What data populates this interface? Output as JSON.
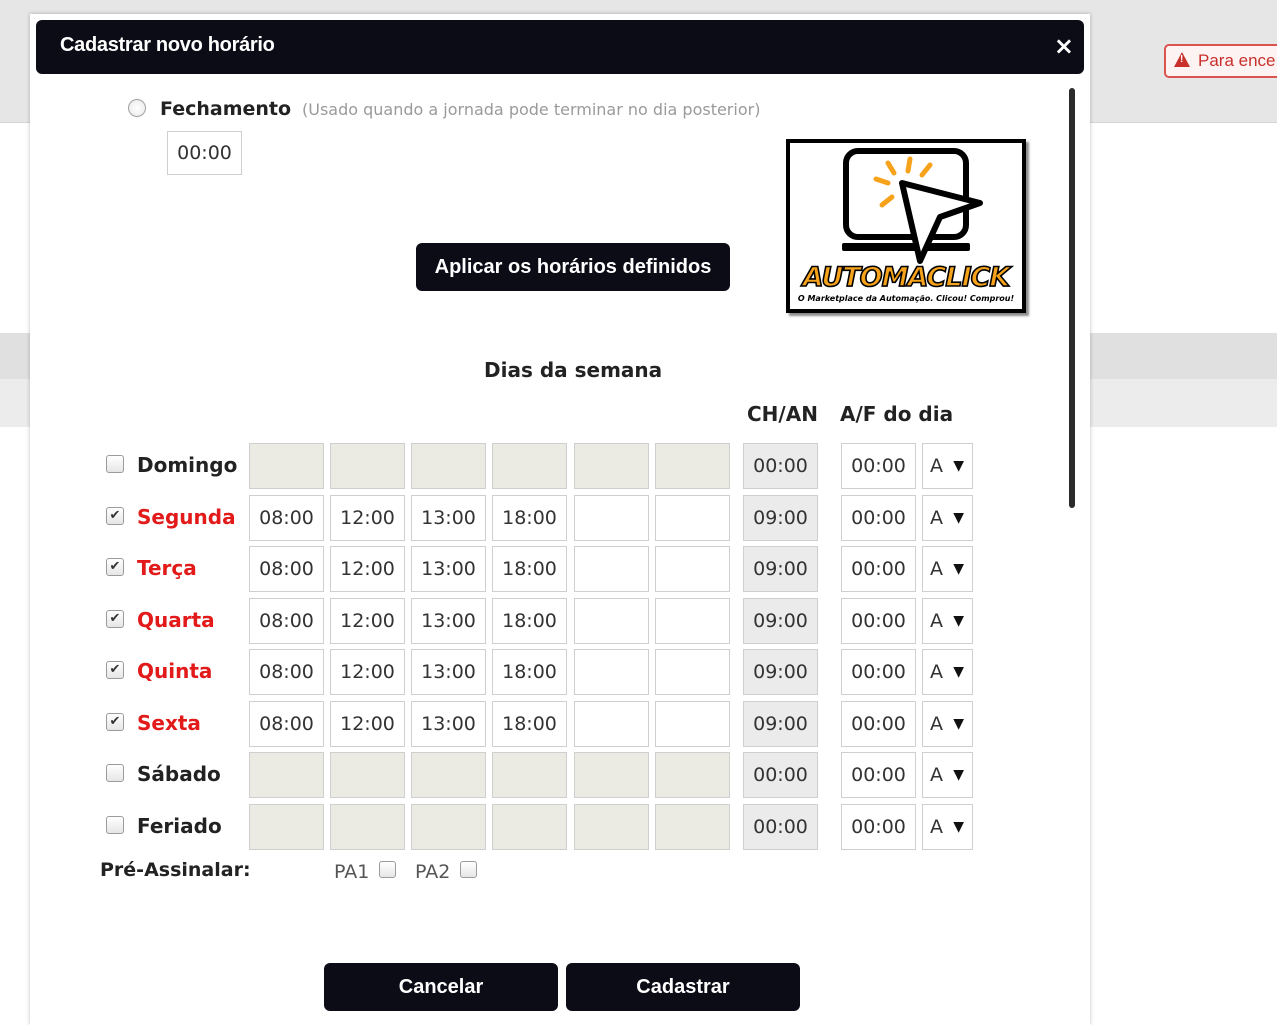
{
  "background": {
    "alert_text": "Para ence"
  },
  "modal": {
    "title": "Cadastrar novo horário",
    "close_symbol": "×"
  },
  "fechamento": {
    "label": "Fechamento",
    "hint": "(Usado quando a jornada pode terminar no dia posterior)",
    "value": "00:00",
    "selected": false
  },
  "apply_button": "Aplicar os horários definidos",
  "logo": {
    "brand": "AUTOMACLICK",
    "tagline": "O Marketplace da Automação. Clicou! Comprou!",
    "accent_color": "#f7a21b"
  },
  "schedule": {
    "title": "Dias da semana",
    "col_ch": "CH/AN",
    "col_af": "A/F do dia",
    "days": [
      {
        "name": "Domingo",
        "checked": false,
        "times": [
          "",
          "",
          "",
          "",
          "",
          ""
        ],
        "ch": "00:00",
        "af": "00:00",
        "mode": "A"
      },
      {
        "name": "Segunda",
        "checked": true,
        "times": [
          "08:00",
          "12:00",
          "13:00",
          "18:00",
          "",
          ""
        ],
        "ch": "09:00",
        "af": "00:00",
        "mode": "A"
      },
      {
        "name": "Terça",
        "checked": true,
        "times": [
          "08:00",
          "12:00",
          "13:00",
          "18:00",
          "",
          ""
        ],
        "ch": "09:00",
        "af": "00:00",
        "mode": "A"
      },
      {
        "name": "Quarta",
        "checked": true,
        "times": [
          "08:00",
          "12:00",
          "13:00",
          "18:00",
          "",
          ""
        ],
        "ch": "09:00",
        "af": "00:00",
        "mode": "A"
      },
      {
        "name": "Quinta",
        "checked": true,
        "times": [
          "08:00",
          "12:00",
          "13:00",
          "18:00",
          "",
          ""
        ],
        "ch": "09:00",
        "af": "00:00",
        "mode": "A"
      },
      {
        "name": "Sexta",
        "checked": true,
        "times": [
          "08:00",
          "12:00",
          "13:00",
          "18:00",
          "",
          ""
        ],
        "ch": "09:00",
        "af": "00:00",
        "mode": "A"
      },
      {
        "name": "Sábado",
        "checked": false,
        "times": [
          "",
          "",
          "",
          "",
          "",
          ""
        ],
        "ch": "00:00",
        "af": "00:00",
        "mode": "A"
      },
      {
        "name": "Feriado",
        "checked": false,
        "times": [
          "",
          "",
          "",
          "",
          "",
          ""
        ],
        "ch": "00:00",
        "af": "00:00",
        "mode": "A"
      }
    ]
  },
  "pre_assinalar": {
    "label": "Pré-Assinalar:",
    "options": [
      "PA1",
      "PA2"
    ]
  },
  "footer": {
    "cancel": "Cancelar",
    "submit": "Cadastrar"
  },
  "colors": {
    "header_bg": "#0c0c17",
    "active_day": "#e21a1a"
  }
}
